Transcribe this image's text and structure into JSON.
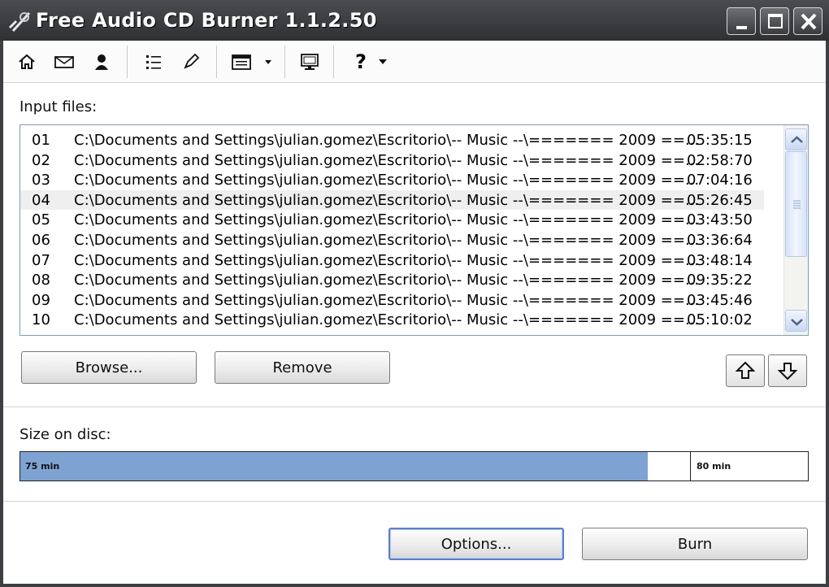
{
  "window": {
    "title": "Free Audio CD Burner 1.1.2.50"
  },
  "toolbar": {
    "icons": [
      "home-icon",
      "mail-icon",
      "user-icon",
      "list-icon",
      "pencil-icon",
      "window-menu-icon",
      "monitor-icon",
      "help-icon"
    ],
    "help_glyph": "?"
  },
  "input_files": {
    "label": "Input files:",
    "rows": [
      {
        "num": "01",
        "path": "C:\\Documents and Settings\\julian.gomez\\Escritorio\\-- Music --\\======= 2009 ==...",
        "time": "05:35:15"
      },
      {
        "num": "02",
        "path": "C:\\Documents and Settings\\julian.gomez\\Escritorio\\-- Music --\\======= 2009 ==...",
        "time": "02:58:70"
      },
      {
        "num": "03",
        "path": "C:\\Documents and Settings\\julian.gomez\\Escritorio\\-- Music --\\======= 2009 ==...",
        "time": "07:04:16"
      },
      {
        "num": "04",
        "path": "C:\\Documents and Settings\\julian.gomez\\Escritorio\\-- Music --\\======= 2009 ==...",
        "time": "05:26:45"
      },
      {
        "num": "05",
        "path": "C:\\Documents and Settings\\julian.gomez\\Escritorio\\-- Music --\\======= 2009 ==...",
        "time": "03:43:50"
      },
      {
        "num": "06",
        "path": "C:\\Documents and Settings\\julian.gomez\\Escritorio\\-- Music --\\======= 2009 ==...",
        "time": "03:36:64"
      },
      {
        "num": "07",
        "path": "C:\\Documents and Settings\\julian.gomez\\Escritorio\\-- Music --\\======= 2009 ==...",
        "time": "03:48:14"
      },
      {
        "num": "08",
        "path": "C:\\Documents and Settings\\julian.gomez\\Escritorio\\-- Music --\\======= 2009 ==...",
        "time": "09:35:22"
      },
      {
        "num": "09",
        "path": "C:\\Documents and Settings\\julian.gomez\\Escritorio\\-- Music --\\======= 2009 ==...",
        "time": "03:45:46"
      },
      {
        "num": "10",
        "path": "C:\\Documents and Settings\\julian.gomez\\Escritorio\\-- Music --\\======= 2009 ==...",
        "time": "05:10:02"
      }
    ],
    "highlighted_row": "04"
  },
  "buttons": {
    "browse": "Browse...",
    "remove": "Remove",
    "options": "Options...",
    "burn": "Burn"
  },
  "size_on_disc": {
    "label": "Size on disc:",
    "used_label": "75 min",
    "capacity_label": "80 min",
    "used_fraction": 0.797,
    "capacity_fraction": 0.85,
    "fill_color": "#7ea3d3"
  }
}
